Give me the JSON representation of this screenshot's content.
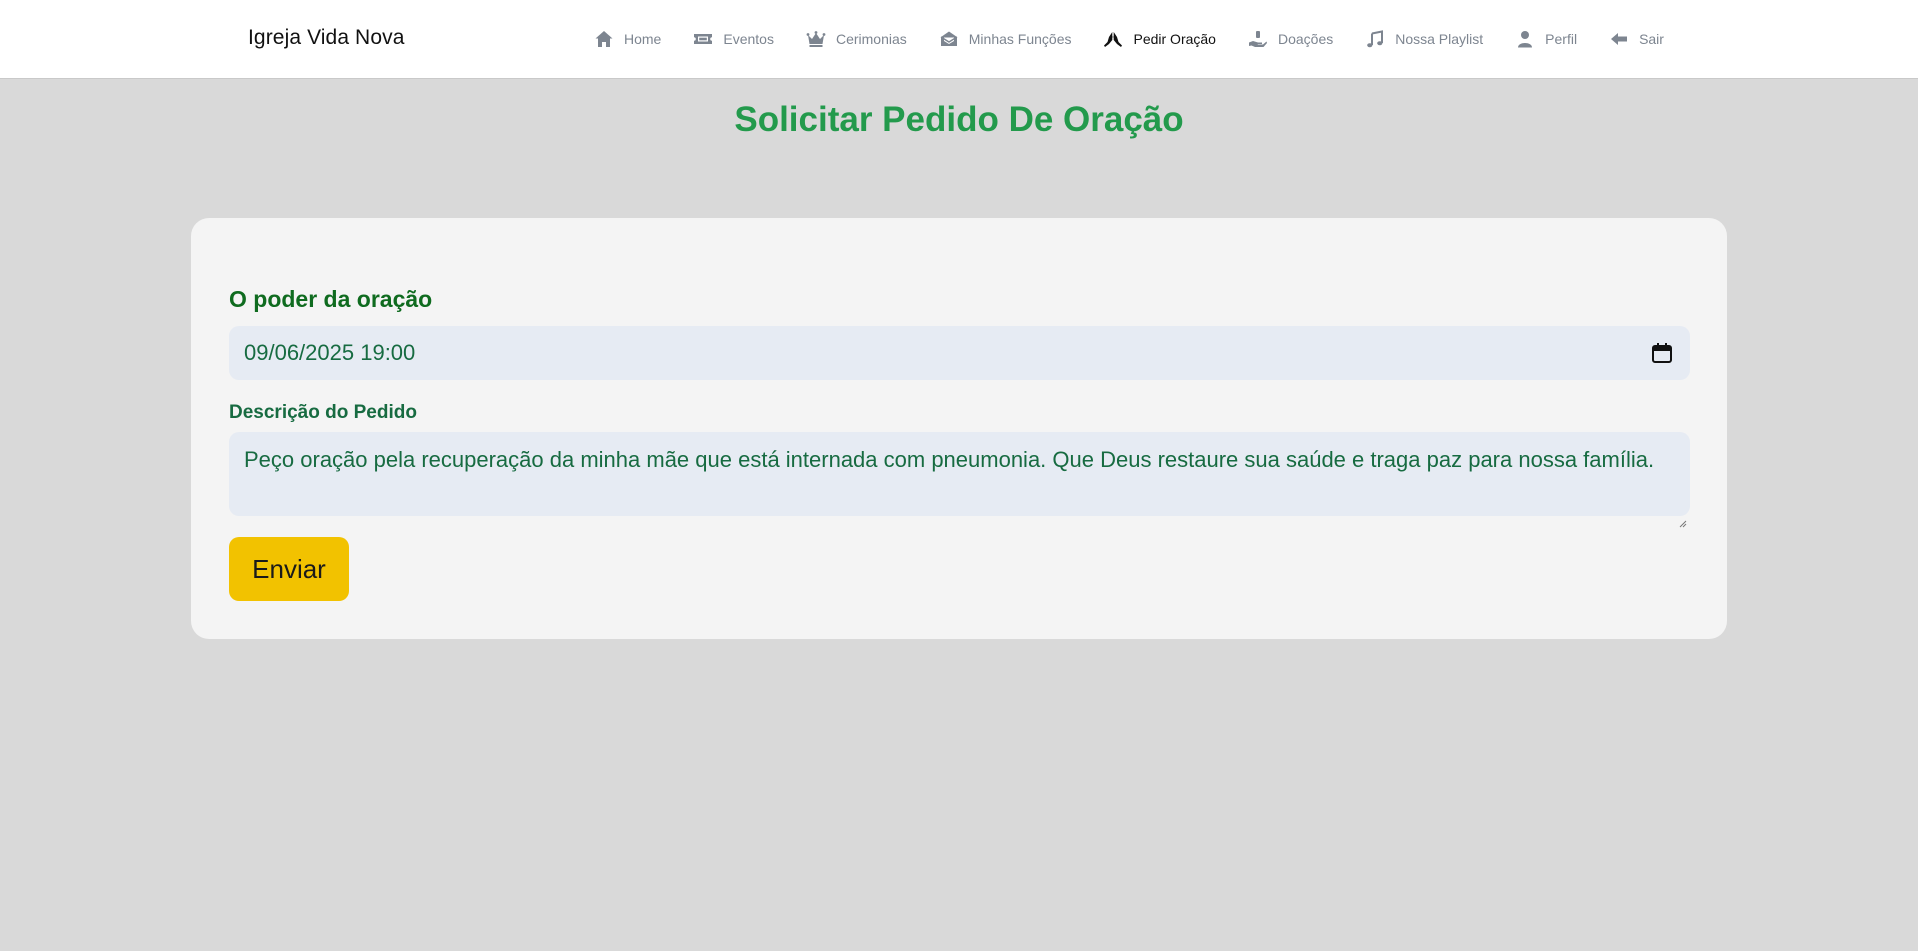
{
  "brand": "Igreja Vida Nova",
  "nav": [
    {
      "label": "Home",
      "icon": "home-icon",
      "active": false
    },
    {
      "label": "Eventos",
      "icon": "ticket-icon",
      "active": false
    },
    {
      "label": "Cerimonias",
      "icon": "crown-icon",
      "active": false
    },
    {
      "label": "Minhas Funções",
      "icon": "envelope-open-icon",
      "active": false
    },
    {
      "label": "Pedir Oração",
      "icon": "praying-hands-icon",
      "active": true
    },
    {
      "label": "Doações",
      "icon": "hand-holding-icon",
      "active": false
    },
    {
      "label": "Nossa Playlist",
      "icon": "music-icon",
      "active": false
    },
    {
      "label": "Perfil",
      "icon": "user-icon",
      "active": false
    },
    {
      "label": "Sair",
      "icon": "arrow-left-icon",
      "active": false
    }
  ],
  "page_title": "Solicitar Pedido De Oração",
  "form": {
    "section_title": "O poder da oração",
    "datetime_value": "09/06/2025 19:00",
    "description_label": "Descrição do Pedido",
    "description_value": "Peço oração pela recuperação da minha mãe que está internada com pneumonia. Que Deus restaure sua saúde e traga paz para nossa família.",
    "submit_label": "Enviar"
  },
  "colors": {
    "page_bg": "#d9d9d9",
    "title_green": "#239a4c",
    "section_green": "#0f6b1f",
    "text_green": "#176b41",
    "button_yellow": "#f2c200",
    "input_bg": "#e6ebf3"
  }
}
